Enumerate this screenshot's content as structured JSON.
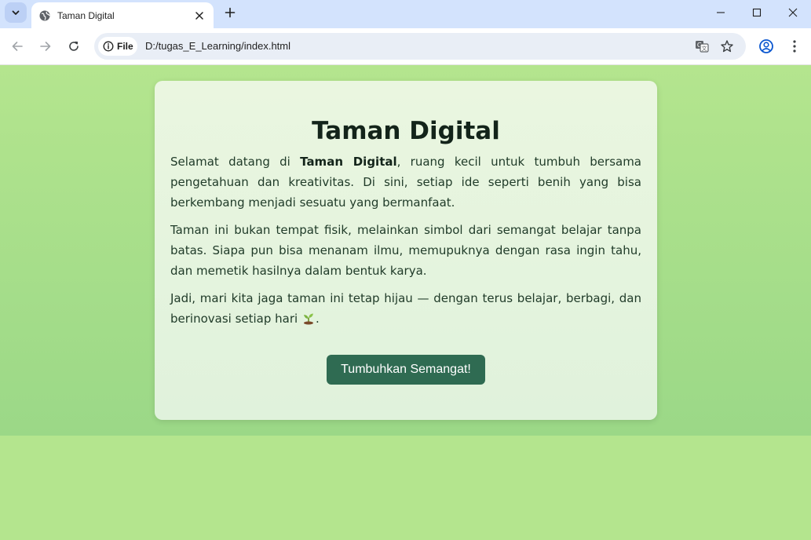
{
  "browser": {
    "tab_title": "Taman Digital",
    "site_chip": "File",
    "url": "D:/tugas_E_Learning/index.html"
  },
  "page": {
    "title": "Taman Digital",
    "p1_before": "Selamat datang di ",
    "p1_bold": "Taman Digital",
    "p1_after": ", ruang kecil untuk tumbuh bersama pengetahuan dan kreativitas. Di sini, setiap ide seperti benih yang bisa berkembang menjadi sesuatu yang bermanfaat.",
    "p2": "Taman ini bukan tempat fisik, melainkan simbol dari semangat belajar tanpa batas. Siapa pun bisa menanam ilmu, memupuknya dengan rasa ingin tahu, dan memetik hasilnya dalam bentuk karya.",
    "p3_before": "Jadi, mari kita jaga taman ini tetap hijau — dengan terus belajar, berbagi, dan berinovasi setiap hari ",
    "p3_after": ".",
    "button_label": "Tumbuhkan Semangat!"
  },
  "colors": {
    "page_bg": "#b4e58e",
    "card_bg": "#eaf6e0",
    "button_bg": "#2f6b52",
    "tabstrip_bg": "#d3e3fd"
  },
  "icons": [
    "tab-search-chevron-icon",
    "globe-icon",
    "close-icon",
    "plus-icon",
    "minimize-icon",
    "maximize-icon",
    "window-close-icon",
    "back-arrow-icon",
    "forward-arrow-icon",
    "reload-icon",
    "info-icon",
    "translate-icon",
    "star-icon",
    "profile-icon",
    "kebab-menu-icon",
    "sprout-icon"
  ]
}
